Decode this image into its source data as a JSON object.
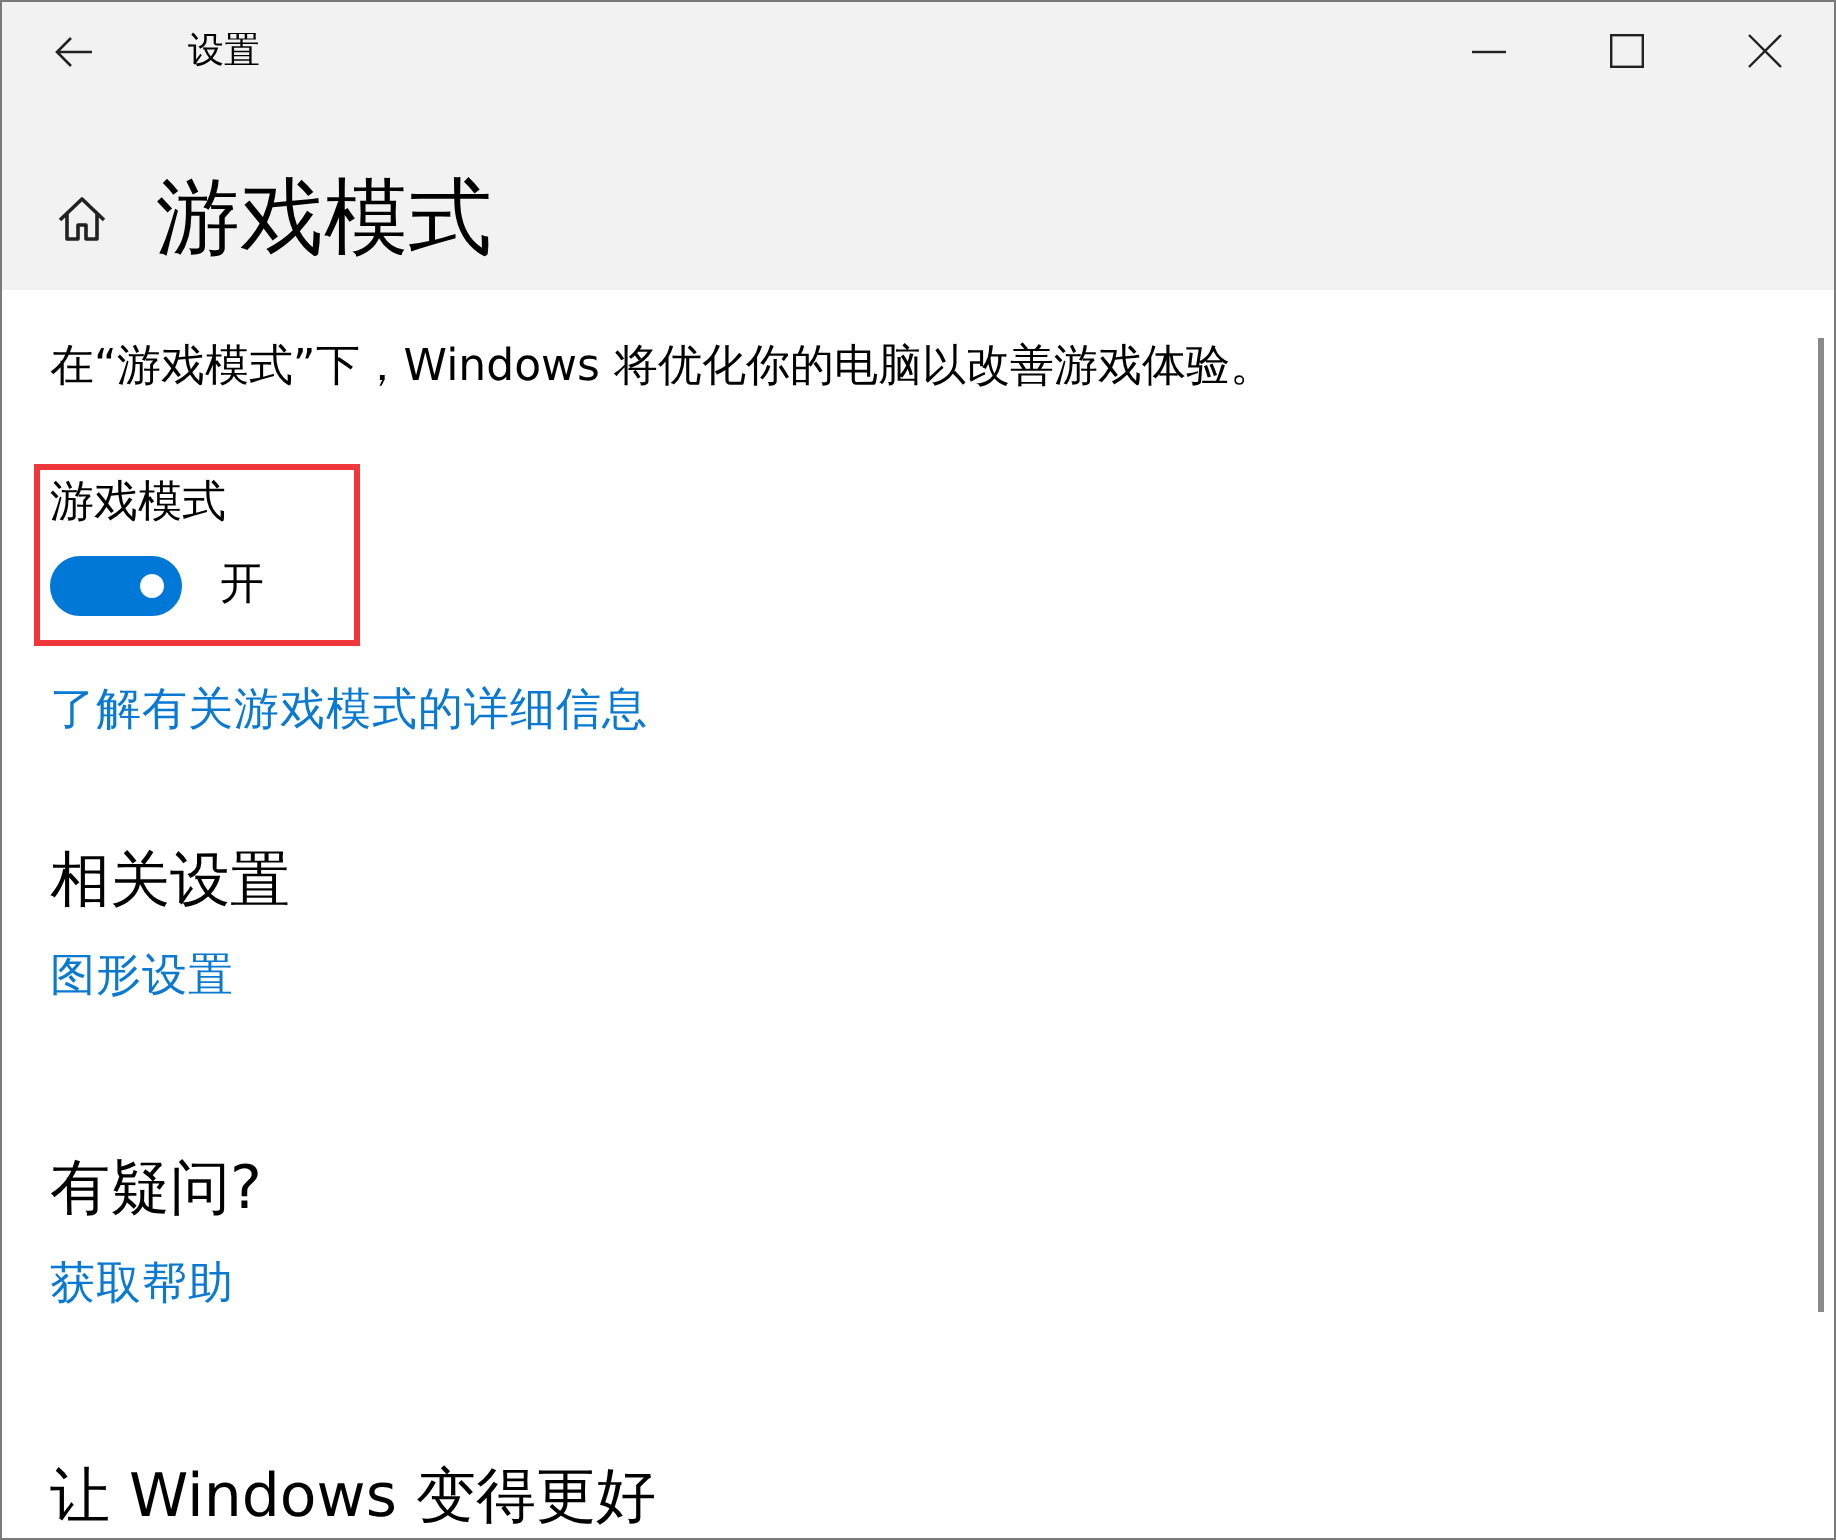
{
  "window": {
    "title": "设置"
  },
  "page": {
    "title": "游戏模式"
  },
  "description": "在“游戏模式”下，Windows 将优化你的电脑以改善游戏体验。",
  "toggle": {
    "label": "游戏模式",
    "on": true,
    "state_text": "开",
    "highlighted": true
  },
  "learn_more_link": "了解有关游戏模式的详细信息",
  "sections": [
    {
      "heading": "相关设置",
      "links": [
        "图形设置"
      ]
    },
    {
      "heading": "有疑问?",
      "links": [
        "获取帮助"
      ]
    },
    {
      "heading": "让 Windows 变得更好"
    }
  ]
}
